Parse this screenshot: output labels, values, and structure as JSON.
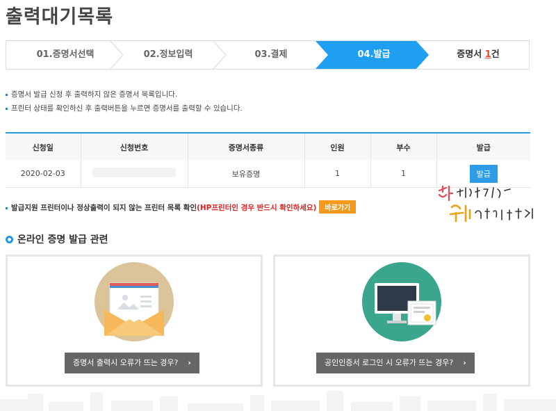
{
  "page_title": "출력대기목록",
  "steps": [
    {
      "label": "01.증명서선택"
    },
    {
      "label": "02.정보입력"
    },
    {
      "label": "03.결제"
    },
    {
      "label": "04.발급"
    }
  ],
  "cert_count": {
    "prefix": "증명서 ",
    "count": "1",
    "suffix": "건"
  },
  "notes": [
    "증명서 발급 신청 후 출력하지 않은 증명서 목록입니다.",
    "프린터 상태를 확인하신 후 출력버튼을 누르면 증명서를 출력할 수 있습니다."
  ],
  "table": {
    "headers": [
      "신청일",
      "신청번호",
      "증명서종류",
      "인원",
      "부수",
      "발급"
    ],
    "rows": [
      {
        "date": "2020-02-03",
        "number": "",
        "type": "보유증명",
        "people": "1",
        "copies": "1",
        "action": "발급"
      }
    ]
  },
  "warning": {
    "text": "발급지원 프린터이나 정상출력이 되지 않는 프린터 목록 확인",
    "red_text": "(HP프린터인 경우 반드시 확인하세요)",
    "button": "바로가기"
  },
  "section_title": "온라인 증명 발급 관련",
  "cards": [
    {
      "label": "증명서 출력시 오류가 뜨는 경우?",
      "icon": "envelope-icon"
    },
    {
      "label": "공인인증서 로그인 시 오류가 뜨는 경우?",
      "icon": "monitor-certificate-icon"
    }
  ],
  "colors": {
    "accent": "#2196e0",
    "active_step": "#1e9ff2",
    "button_orange": "#f79a1c",
    "warning_red": "#e0201e"
  }
}
